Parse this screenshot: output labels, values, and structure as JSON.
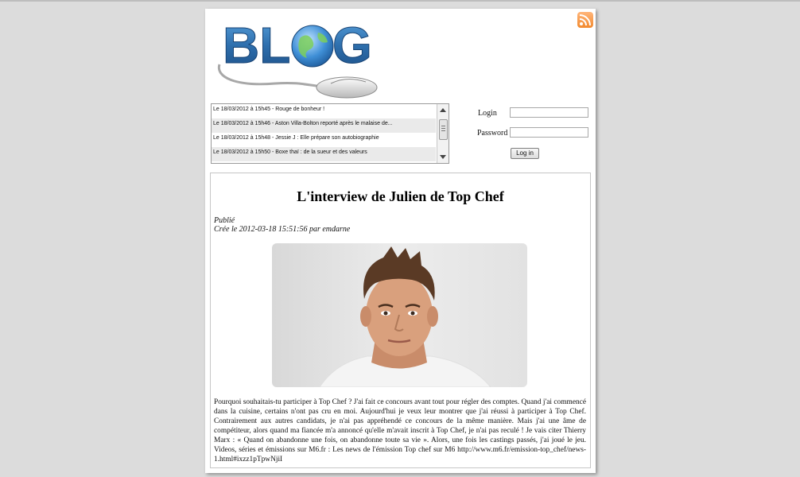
{
  "logo": {
    "text": "BLOG"
  },
  "ticker": {
    "items": [
      {
        "label": "Le 18/03/2012 à 15h45 - Rouge de bonheur !"
      },
      {
        "label": "Le 18/03/2012 à 15h46 - Aston Villa-Bolton reporté après le malaise de..."
      },
      {
        "label": "Le 18/03/2012 à 15h48 - Jessie J : Elle prépare son autobiographie"
      },
      {
        "label": "Le 18/03/2012 à 15h50 - Boxe thaï : de la sueur et des valeurs"
      }
    ]
  },
  "login": {
    "login_label": "Login",
    "password_label": "Password",
    "button_label": "Log in"
  },
  "article": {
    "title": "L'interview de Julien de Top Chef",
    "status": "Publié",
    "meta": "Crée le 2012-03-18 15:51:56 par emdarne",
    "body": "Pourquoi souhaitais-tu participer à Top Chef ? J'ai fait ce concours avant tout pour régler des comptes. Quand j'ai commencé dans la cuisine, certains n'ont pas cru en moi. Aujourd'hui je veux leur montrer que j'ai réussi à participer à Top Chef. Contrairement aux autres candidats, je n'ai pas appréhendé ce concours de la même manière. Mais j'ai une âme de compétiteur, alors quand ma fiancée m'a annoncé qu'elle m'avait inscrit à Top Chef, je n'ai pas reculé ! Je vais citer Thierry Marx : « Quand on abandonne une fois, on abandonne toute sa vie ». Alors, une fois les castings passés, j'ai joué le jeu. Videos, séries et émissions sur M6.fr : Les news de l'émission Top chef sur M6 http://www.m6.fr/emission-top_chef/news-1.html#ixzz1pTpwNjiI"
  },
  "icons": {
    "rss": "rss-feed-icon",
    "logo_globe": "globe-icon",
    "logo_mouse": "computer-mouse-icon"
  },
  "colors": {
    "logo_blue": "#2e6fad",
    "rss_orange": "#f28a2f",
    "page_bg": "#dcdcdc"
  }
}
